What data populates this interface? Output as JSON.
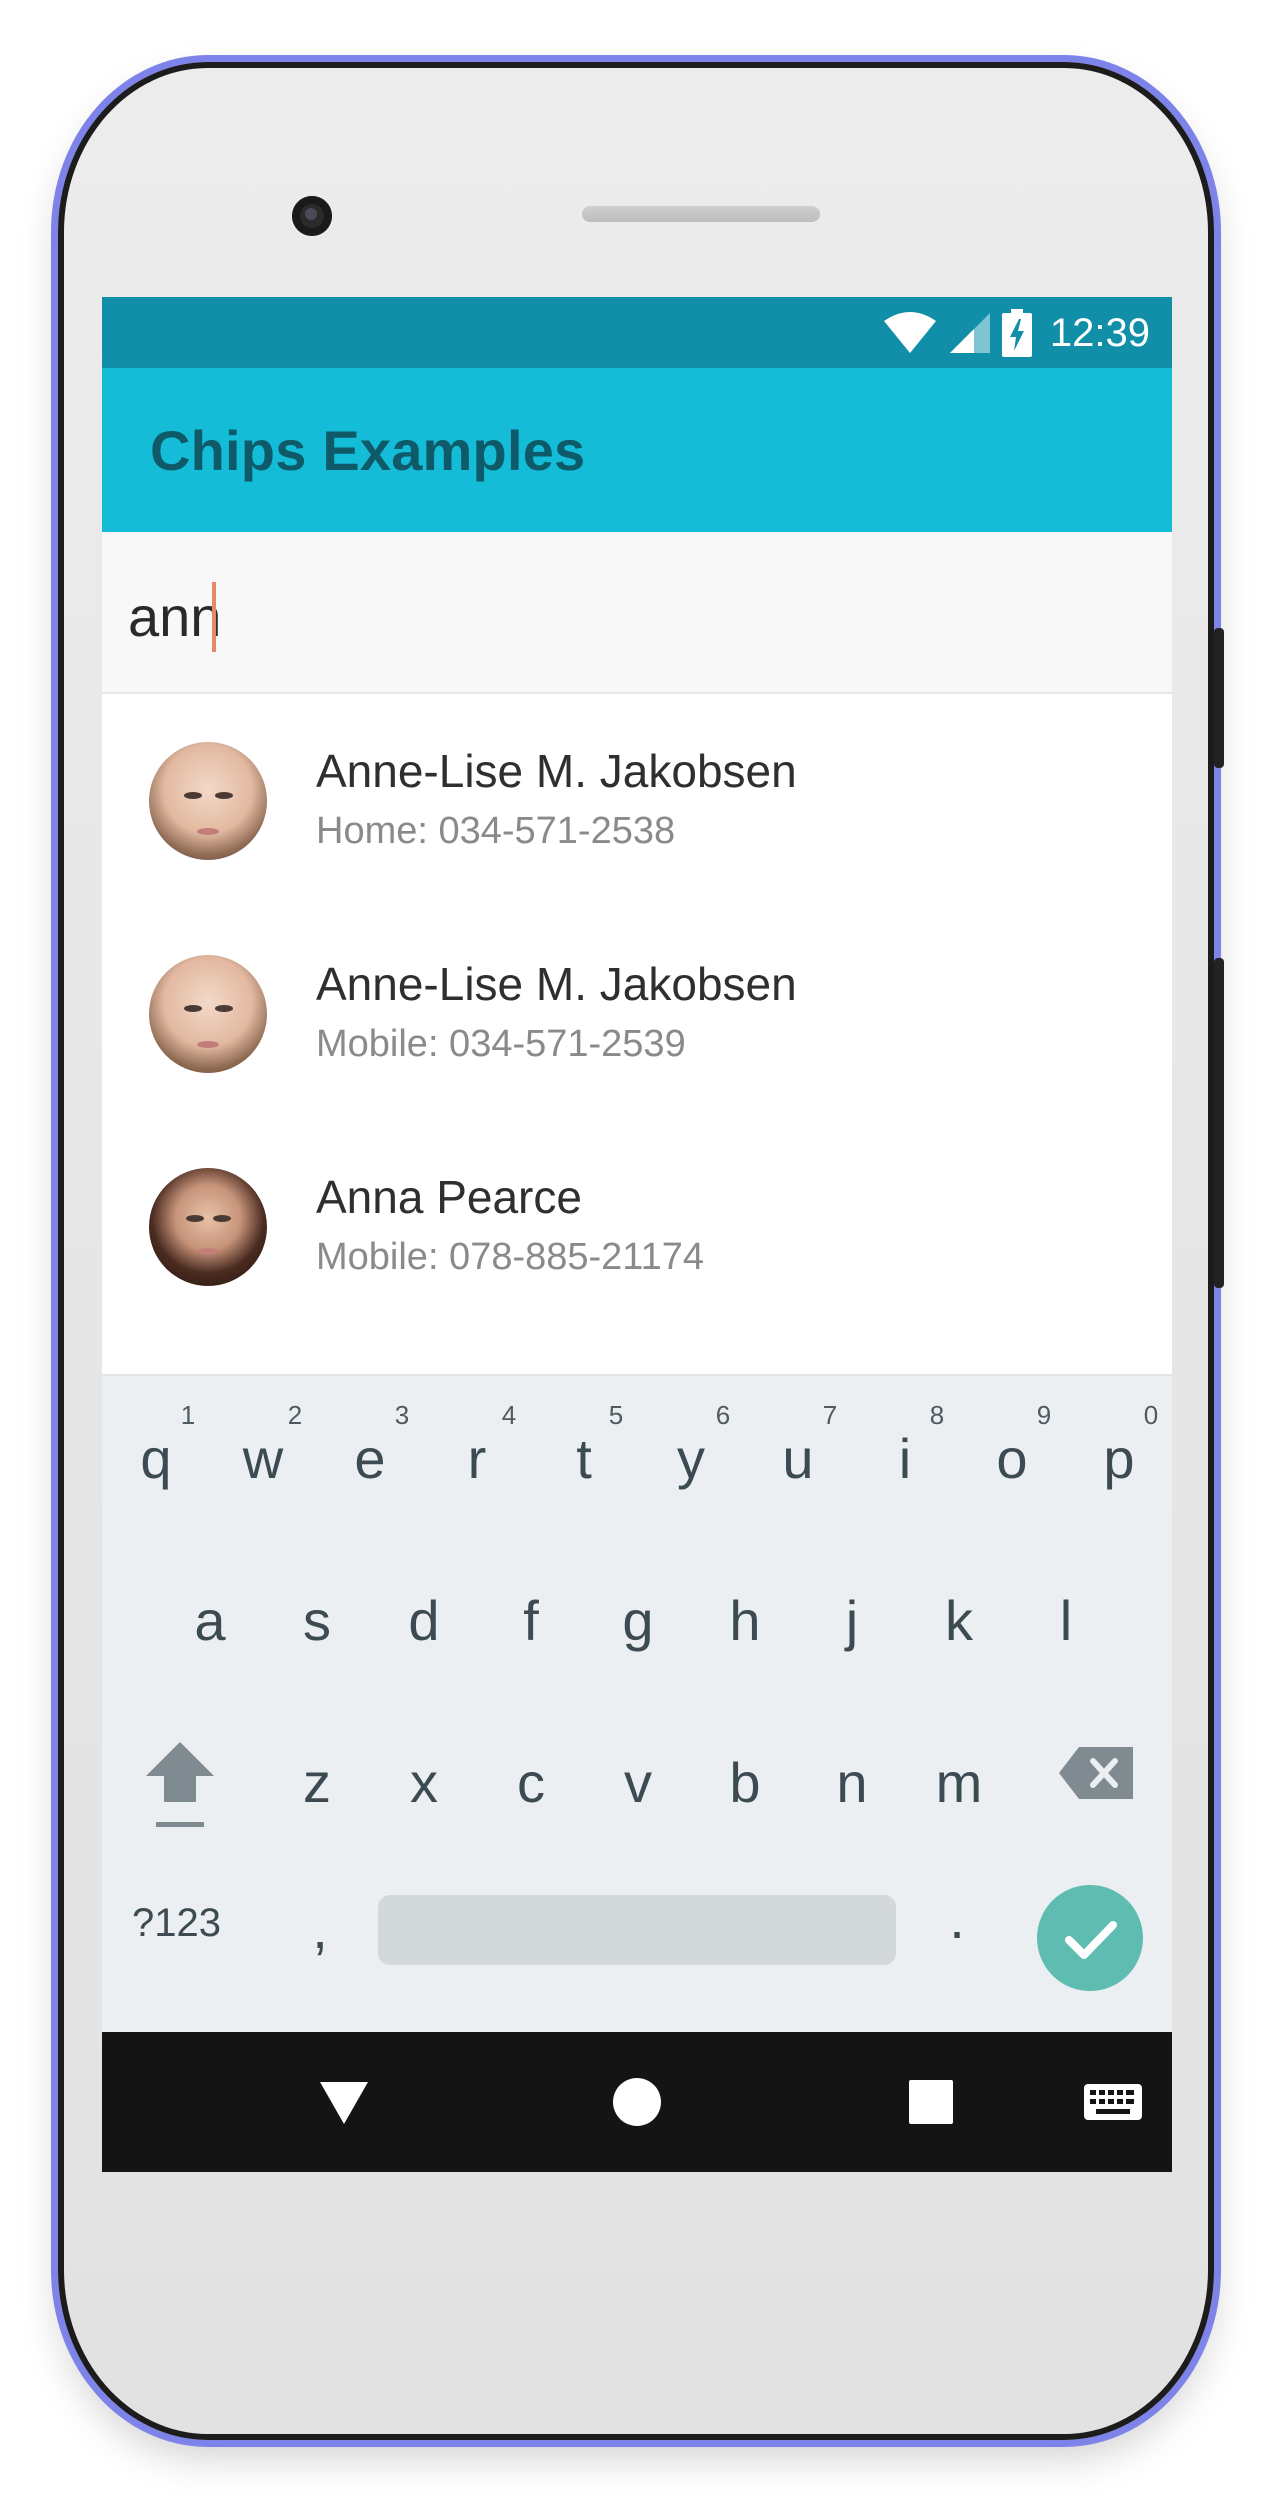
{
  "status_bar": {
    "time": "12:39"
  },
  "app_bar": {
    "title": "Chips Examples"
  },
  "input": {
    "value": "ann"
  },
  "suggestions": [
    {
      "name": "Anne-Lise M. Jakobsen",
      "detail": "Home: 034-571-2538"
    },
    {
      "name": "Anne-Lise M. Jakobsen",
      "detail": "Mobile: 034-571-2539"
    },
    {
      "name": "Anna Pearce",
      "detail": "Mobile: 078-885-21174"
    }
  ],
  "keyboard": {
    "row1": [
      "q",
      "w",
      "e",
      "r",
      "t",
      "y",
      "u",
      "i",
      "o",
      "p"
    ],
    "row1_hints": [
      "1",
      "2",
      "3",
      "4",
      "5",
      "6",
      "7",
      "8",
      "9",
      "0"
    ],
    "row2": [
      "a",
      "s",
      "d",
      "f",
      "g",
      "h",
      "j",
      "k",
      "l"
    ],
    "row3": [
      "z",
      "x",
      "c",
      "v",
      "b",
      "n",
      "m"
    ],
    "symbols_label": "?123",
    "comma": ",",
    "period": "."
  },
  "icons": {
    "wifi": "wifi-icon",
    "signal": "cellular-signal-icon",
    "battery": "battery-charging-icon",
    "shift": "shift-icon",
    "backspace": "backspace-icon",
    "enter": "checkmark-icon",
    "back": "back-triangle-icon",
    "home": "home-circle-icon",
    "recents": "recents-square-icon",
    "keyboard_switch": "keyboard-icon"
  },
  "colors": {
    "status_bar": "#118fa8",
    "app_bar": "#14bcd7",
    "title_text": "#0e5a69",
    "cursor": "#e9876c",
    "enter_key": "#5ebdb0",
    "nav_bar": "#141414",
    "keyboard_bg": "#eceff1"
  }
}
